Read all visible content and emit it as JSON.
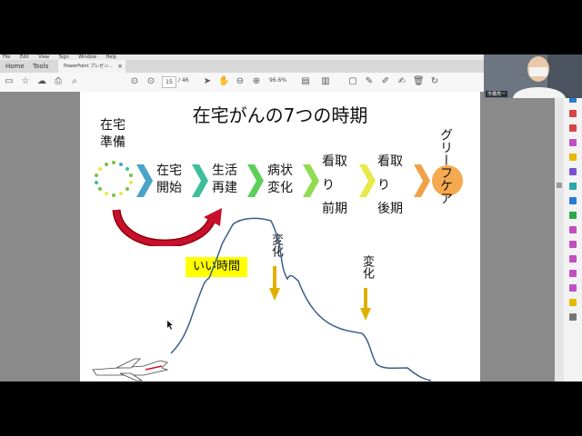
{
  "menubar": {
    "items": [
      "File",
      "Edit",
      "View",
      "Sign",
      "Window",
      "Help"
    ]
  },
  "tabs": [
    {
      "label": "Home",
      "active": false
    },
    {
      "label": "Tools",
      "active": false
    },
    {
      "label": "PowerPoint プレゼン...",
      "active": true,
      "close": "×"
    }
  ],
  "toolbar": {
    "page_current": "15",
    "page_total": "/ 46",
    "zoom": "96.6%"
  },
  "video": {
    "name": "市橋亮一"
  },
  "slide": {
    "title": "在宅がんの7つの時期",
    "stages": [
      {
        "label": "在宅\n準備"
      },
      {
        "label": "在宅\n開始"
      },
      {
        "label": "生活\n再建"
      },
      {
        "label": "病状\n変化"
      },
      {
        "label": "看取\nり\n前期"
      },
      {
        "label": "看取\nり\n後期"
      },
      {
        "label": "グリーフケア"
      }
    ],
    "good_time": "いい時間",
    "change_1": "変化",
    "change_2": "変化"
  },
  "colors": {
    "chevron_blue": "#4aa3c8",
    "chevron_teal": "#3cbf9a",
    "chevron_green": "#5ccf5a",
    "chevron_lightgreen": "#8fdd4f",
    "chevron_yellow": "#e8e84a",
    "chevron_orange": "#f0a24a",
    "grief_circle": "#f5a950",
    "highlight_yellow": "#ffff00",
    "arrow_red": "#c8102e",
    "arrow_down": "#e0b000",
    "curve": "#3a5f8a"
  }
}
